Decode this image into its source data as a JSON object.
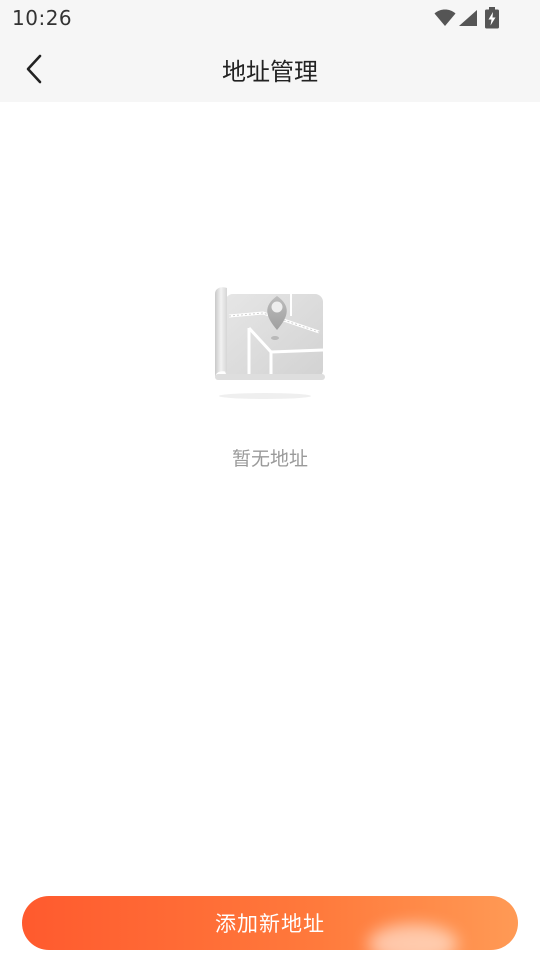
{
  "status_bar": {
    "time": "10:26",
    "icons": [
      "wifi-icon",
      "cellular-signal-icon",
      "battery-charging-icon"
    ]
  },
  "nav": {
    "back_icon": "chevron-left-icon",
    "title": "地址管理"
  },
  "empty_state": {
    "illustration": "map-pin-icon",
    "message": "暂无地址"
  },
  "actions": {
    "add_label": "添加新地址"
  },
  "colors": {
    "accent_start": "#ff5a2e",
    "accent_end": "#ff9a55",
    "nav_background": "#f6f6f6",
    "muted_text": "#9a9a9a"
  }
}
